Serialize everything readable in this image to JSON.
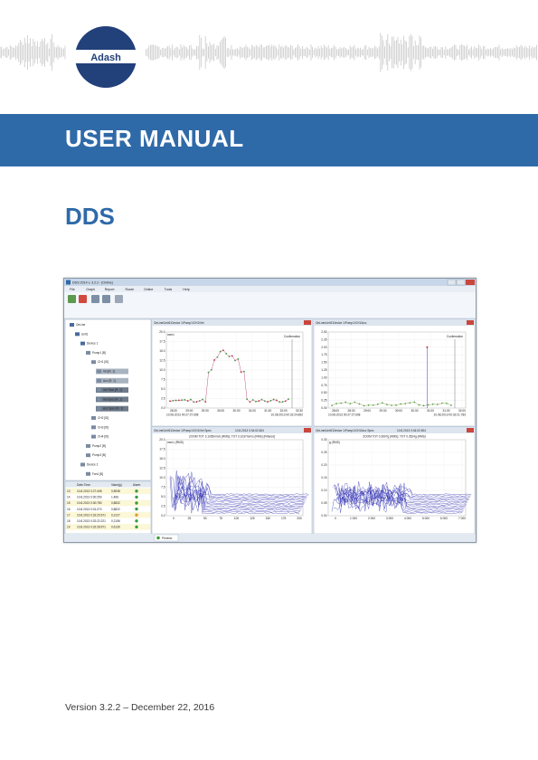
{
  "logo": {
    "text": "Adash"
  },
  "banner": {
    "title": "USER MANUAL"
  },
  "product": {
    "name": "DDS"
  },
  "footer": {
    "version_line": "Version 3.2.2 – December 22, 2016"
  },
  "colors": {
    "banner": "#2f6aa8",
    "title_blue": "#2f6aa8",
    "logo_navy": "#22407a"
  },
  "screenshot": {
    "window_title": "DDS 2014 v. 3.2.2 - [Online]",
    "menu": [
      "File",
      "Graph",
      "Report",
      "Route",
      "Online",
      "Tools",
      "Help"
    ],
    "tree": {
      "root": "OnLine",
      "nodes": [
        "Unit1",
        "Device 1",
        "Pump1 [B]",
        "CH1 [ID]",
        "Vel [R, 1]",
        "Acc [R, 1]",
        "Vel Time [R, 1]",
        "Vel Spec [R, 1]",
        "Acc Spec [R, 1]",
        "CH2 [ID]",
        "CH3 [ID]",
        "CH4 [ID]",
        "Pump2 [B]",
        "Pump3 [B]",
        "Device 2",
        "Fan1 [B]"
      ]
    },
    "table": {
      "headers": [
        "",
        "Date-Time",
        "Value[g]",
        "Alarm"
      ],
      "rows": [
        [
          "13",
          "10.8.2013 0:27:408",
          "0,8938",
          "green"
        ],
        [
          "14",
          "10.8.2013 0:30:250",
          "1,466",
          "green"
        ],
        [
          "15",
          "10.8.2013 0:30:780",
          "0,8832",
          "green"
        ],
        [
          "16",
          "10.8.2013 0:31:270",
          "0,8822",
          "green"
        ],
        [
          "17",
          "10.8.2013 0:32:20:671",
          "0,2127",
          "orange"
        ],
        [
          "18",
          "10.8.2013 0:32:22:221",
          "0,2156",
          "green"
        ],
        [
          "19",
          "10.8.2013 0:32:28:671",
          "0,6139",
          "green"
        ]
      ]
    },
    "charts": {
      "top_left": {
        "title": "OnLine\\Unit1\\Device 1\\Pump1\\CH1\\Vel",
        "ylabel": "mm/s",
        "yticks": [
          "0.0",
          "2.5",
          "5.0",
          "7.5",
          "10.0",
          "12.5",
          "15.0",
          "17.5",
          "20.0"
        ],
        "xticks": [
          "28:30",
          "29:00",
          "29:30",
          "30:00",
          "30:30",
          "31:00",
          "31:30",
          "32:00",
          "32:30"
        ],
        "x_start": "10.08.2013 00:27:27.608",
        "x_end": "10.08.2013 00:32:24.892",
        "annotation": "Confirmation"
      },
      "top_right": {
        "title": "OnLine\\Unit1\\Device 1\\Pump1\\CH1\\Acc",
        "yticks": [
          "0.00",
          "0.25",
          "0.50",
          "0.75",
          "1.00",
          "1.25",
          "1.50",
          "1.75",
          "2.00",
          "2.25",
          "2.50"
        ],
        "xticks": [
          "28:00",
          "28:30",
          "29:00",
          "29:30",
          "30:00",
          "30:30",
          "31:00",
          "31:30",
          "32:00"
        ],
        "x_start": "10.08.2013 00:27:27.608",
        "x_end": "10.08.2013 00:32:21.783",
        "annotation": "Confirmation"
      },
      "bottom_left": {
        "title": "OnLine\\Unit1\\Device 1\\Pump1\\CH1\\Vel Spec",
        "timestamp": "10.8.2013 0:34:02.604",
        "subtitle": "ZOOM TOT 3.1035mm/s (RMS); TOT 3.1037mm/s (RMS) [Filtered]",
        "ylabel": "mm/s (RMS)",
        "yticks": [
          "0.0",
          "2.5",
          "5.0",
          "7.5",
          "10.0",
          "12.5",
          "15.0",
          "17.5",
          "20.0"
        ],
        "xticks": [
          "0",
          "25",
          "50",
          "75",
          "100",
          "125",
          "150",
          "175",
          "200"
        ]
      },
      "bottom_right": {
        "title": "OnLine\\Unit1\\Device 1\\Pump1\\CH1\\Acc Spec",
        "timestamp": "10.8.2013 0:34:02.504",
        "subtitle": "ZOOM TOT 0.3607g (RMS); TOT 0.3524g (RMS)",
        "ylabel": "g (RMS)",
        "yticks": [
          "0.00",
          "0.05",
          "0.10",
          "0.15",
          "0.20",
          "0.25",
          "0.30"
        ],
        "xticks": [
          "0",
          "1 000",
          "2 000",
          "3 000",
          "4 000",
          "5 000",
          "6 000",
          "7 000"
        ]
      }
    },
    "status_tab": "Preview"
  }
}
